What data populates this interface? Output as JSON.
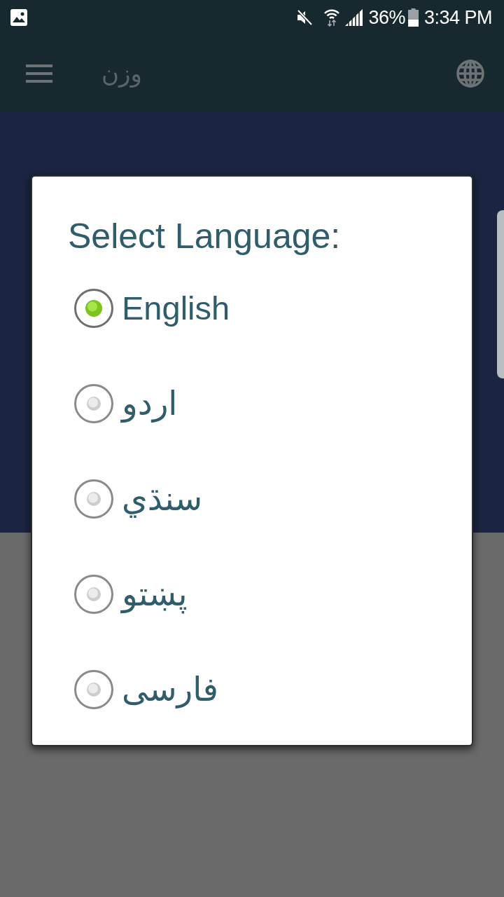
{
  "status_bar": {
    "battery": "36%",
    "time": "3:34 PM"
  },
  "app_bar": {
    "title": "وزن"
  },
  "dialog": {
    "title": "Select Language:",
    "options": [
      {
        "label": "English",
        "selected": true
      },
      {
        "label": "اردو",
        "selected": false
      },
      {
        "label": "سنڌي",
        "selected": false
      },
      {
        "label": "پښتو",
        "selected": false
      },
      {
        "label": "فارسی",
        "selected": false
      }
    ]
  }
}
